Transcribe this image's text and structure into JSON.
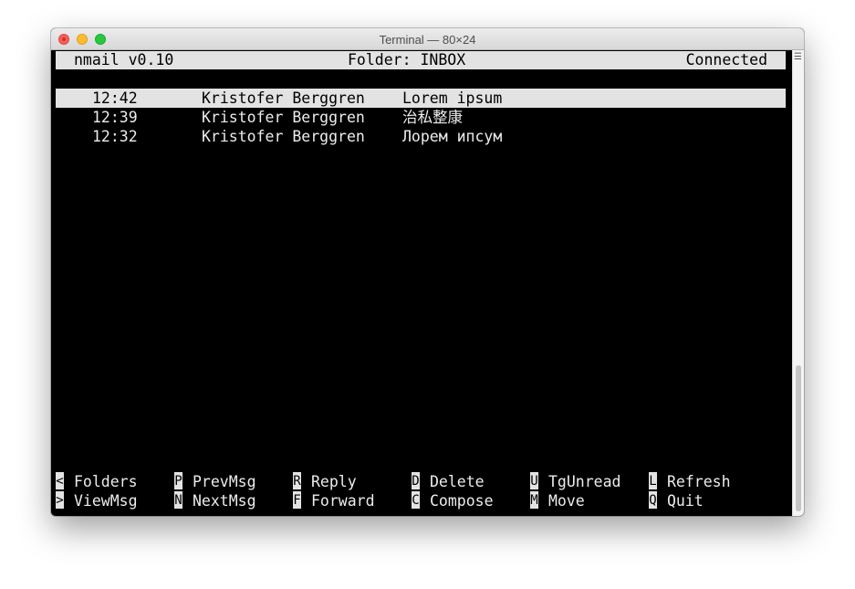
{
  "window": {
    "title": "Terminal — 80×24"
  },
  "status": {
    "app": "nmail v0.10",
    "folder": "Folder: INBOX",
    "connection": "Connected"
  },
  "messages": [
    {
      "time": "12:42",
      "from": "Kristofer Berggren",
      "subject": "Lorem ipsum"
    },
    {
      "time": "12:39",
      "from": "Kristofer Berggren",
      "subject": "治私整康"
    },
    {
      "time": "12:32",
      "from": "Kristofer Berggren",
      "subject": "Лорем ипсум"
    }
  ],
  "help": {
    "row1": [
      {
        "key": "<",
        "label": "Folders"
      },
      {
        "key": "P",
        "label": "PrevMsg"
      },
      {
        "key": "R",
        "label": "Reply"
      },
      {
        "key": "D",
        "label": "Delete"
      },
      {
        "key": "U",
        "label": "TgUnread"
      },
      {
        "key": "L",
        "label": "Refresh"
      }
    ],
    "row2": [
      {
        "key": ">",
        "label": "ViewMsg"
      },
      {
        "key": "N",
        "label": "NextMsg"
      },
      {
        "key": "F",
        "label": "Forward"
      },
      {
        "key": "C",
        "label": "Compose"
      },
      {
        "key": "M",
        "label": "Move"
      },
      {
        "key": "Q",
        "label": "Quit"
      }
    ]
  }
}
